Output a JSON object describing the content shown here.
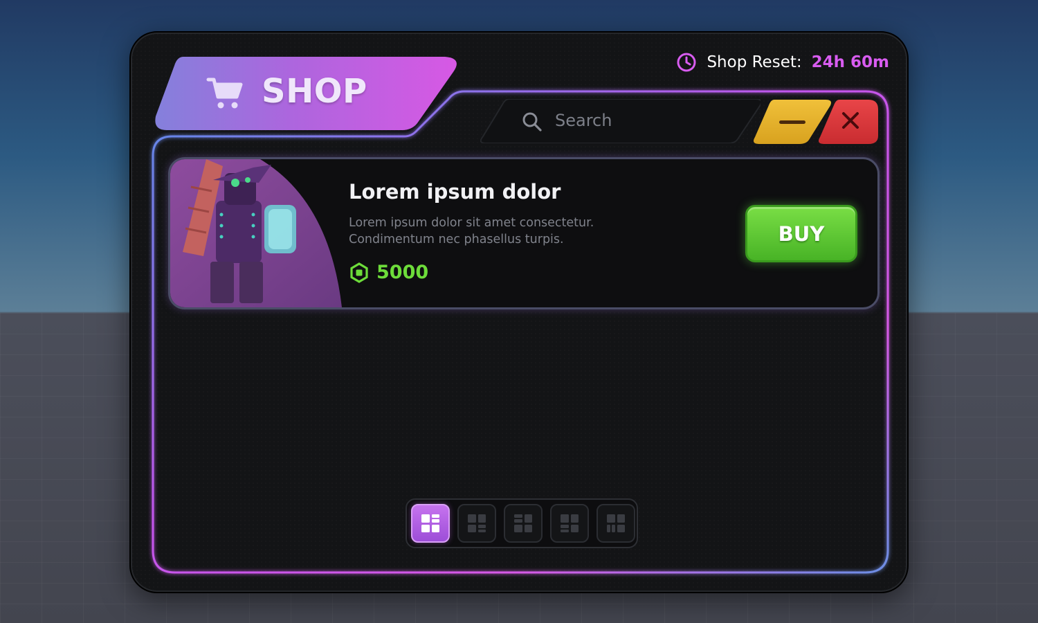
{
  "header": {
    "reset_label": "Shop Reset:",
    "reset_value": "24h 60m",
    "title": "SHOP"
  },
  "search": {
    "placeholder": "Search"
  },
  "item": {
    "title": "Lorem ipsum dolor",
    "description": "Lorem ipsum dolor sit amet consectetur. Condimentum nec phasellus turpis.",
    "price": "5000",
    "buy_label": "BUY"
  },
  "pagination": {
    "count": 5,
    "active_index": 0
  },
  "icons": {
    "clock": "clock-icon",
    "cart": "cart-icon",
    "search": "search-icon",
    "minimize": "minimize-icon",
    "close": "close-icon",
    "currency": "robux-icon",
    "page": "grid-layout-icon"
  },
  "colors": {
    "accent": "#d85cf0",
    "price": "#6ddc3a",
    "buy": "#5cc632",
    "minimize": "#e3b12a",
    "close": "#d93a3d"
  }
}
